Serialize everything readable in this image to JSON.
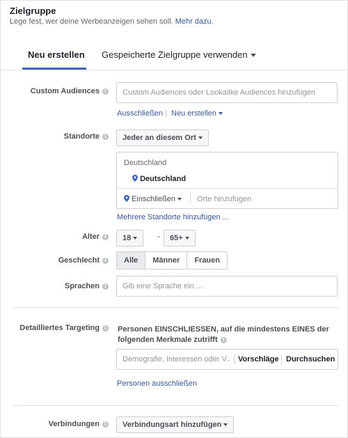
{
  "header": {
    "title": "Zielgruppe",
    "subtitle": "Lege fest, wer deine Werbeanzeigen sehen soll.",
    "more_link": "Mehr dazu."
  },
  "tabs": [
    {
      "label": "Neu erstellen",
      "active": true
    },
    {
      "label": "Gespeicherte Zielgruppe verwenden",
      "active": false
    }
  ],
  "custom_audiences": {
    "label": "Custom Audiences",
    "placeholder": "Custom Audiences oder Lookalike Audiences hinzufügen",
    "exclude_link": "Ausschließen",
    "separator": "|",
    "create_link": "Neu erstellen"
  },
  "locations": {
    "label": "Standorte",
    "dropdown": "Jeder an diesem Ort",
    "country_header": "Deutschland",
    "selected": "Deutschland",
    "include_dropdown": "Einschließen",
    "add_placeholder": "Orte hinzufügen",
    "multi_link": "Mehrere Standorte hinzufügen ..."
  },
  "age": {
    "label": "Alter",
    "min": "18",
    "separator": "-",
    "max": "65+"
  },
  "gender": {
    "label": "Geschlecht",
    "options": [
      "Alle",
      "Männer",
      "Frauen"
    ],
    "selected": "Alle"
  },
  "languages": {
    "label": "Sprachen",
    "placeholder": "Gib eine Sprache ein ..."
  },
  "detailed_targeting": {
    "label": "Detailliertes Targeting",
    "description": "Personen EINSCHLIESSEN, auf die mindestens EINES der folgenden Merkmale zutrifft",
    "placeholder": "Demografie, Interessen oder V..",
    "suggestions": "Vorschläge",
    "browse": "Durchsuchen",
    "exclude_link": "Personen ausschließen"
  },
  "connections": {
    "label": "Verbindungen",
    "dropdown": "Verbindungsart hinzufügen"
  },
  "colors": {
    "accent": "#4267b2",
    "link": "#365899",
    "text": "#1d2129",
    "border": "#ccd0d5"
  },
  "icons": {
    "info": "info-icon",
    "pin": "location-pin-icon",
    "caret": "caret-down-icon"
  }
}
